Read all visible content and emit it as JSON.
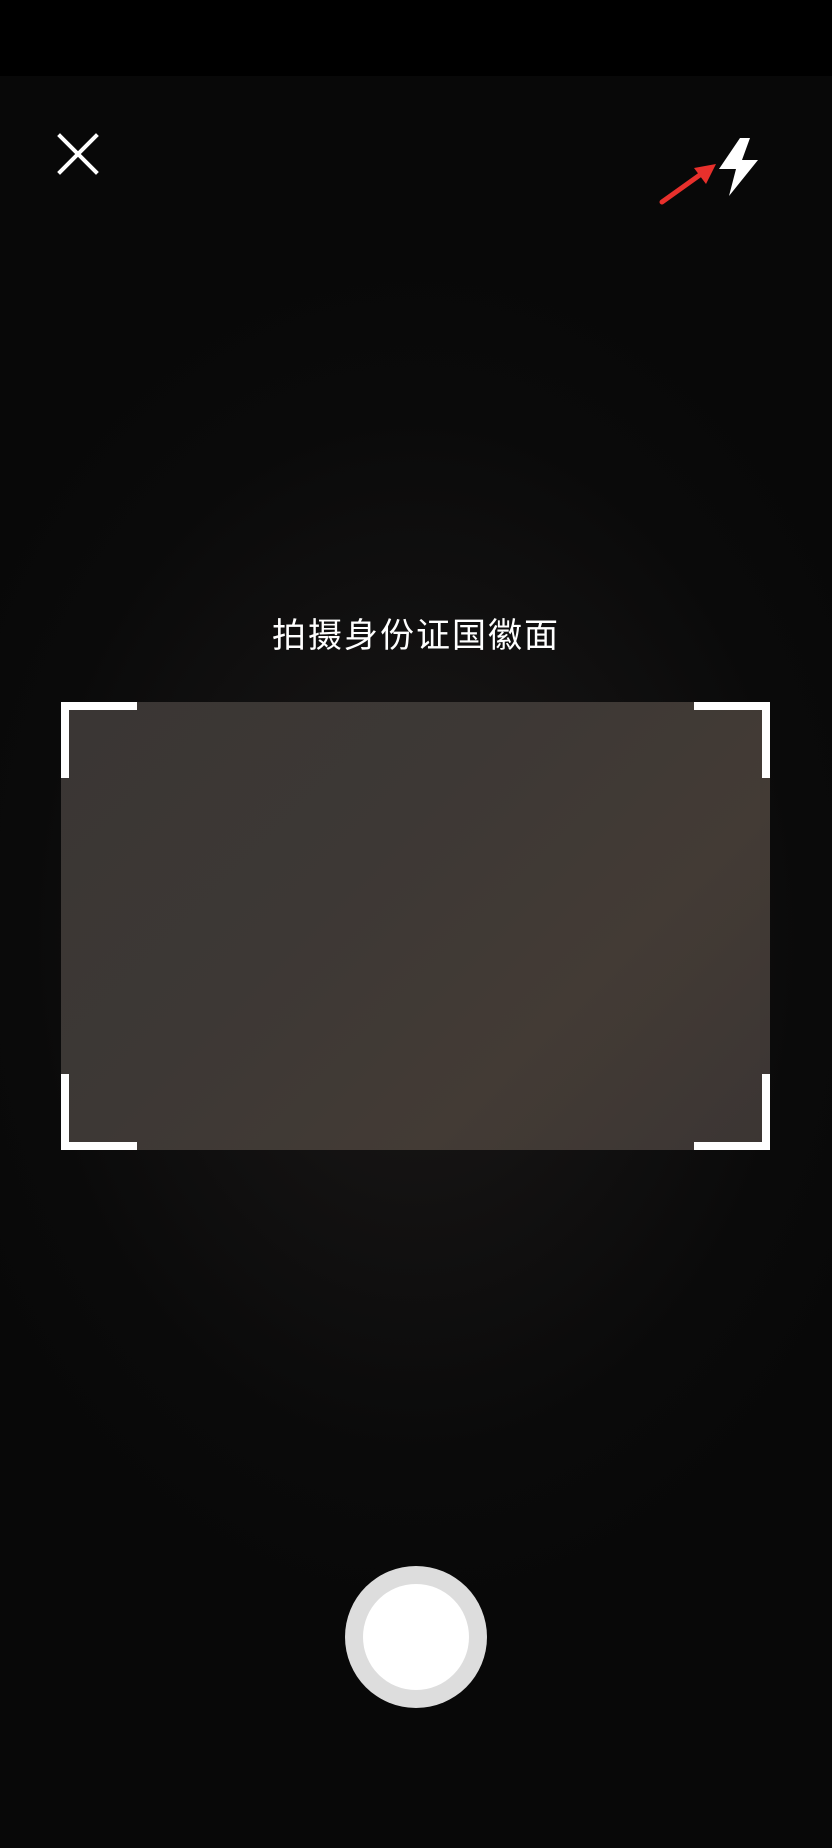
{
  "header": {
    "close_icon": "close-icon",
    "flash_icon": "flash-icon",
    "annotation": "red-arrow-pointing-at-flash"
  },
  "instruction": {
    "text": "拍摄身份证国徽面"
  },
  "scan_frame": {
    "corner_color": "#ffffff",
    "fill_color": "#3d3835"
  },
  "controls": {
    "shutter_icon": "shutter-button"
  },
  "colors": {
    "background": "#000000",
    "annotation_arrow": "#e8302c",
    "text": "#ffffff"
  }
}
